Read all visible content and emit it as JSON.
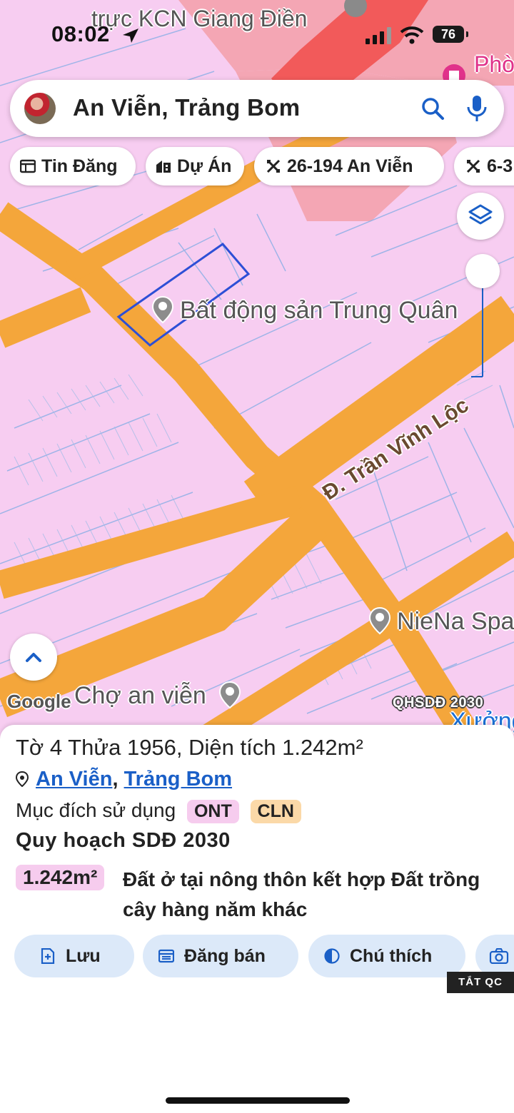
{
  "status_bar": {
    "time": "08:02",
    "battery": "76"
  },
  "map": {
    "top_label": "trực KCN Giang Điền",
    "corner_label": "Phò",
    "pins": [
      {
        "label": "Bất động sản Trung Quân"
      },
      {
        "label": "NieNa Spa"
      },
      {
        "label": "Chợ an viễn"
      },
      {
        "label": "Xưởng"
      }
    ],
    "road_label": "Đ. Trần Vĩnh Lộc",
    "google_logo": "Google",
    "plan_label": "QHSDĐ 2030",
    "colors": {
      "land": "#f7cdf1",
      "road": "#f4a63b",
      "pink_zone": "#f4a6b4",
      "red_zone": "#f25a5a"
    }
  },
  "search": {
    "query": "An Viễn, Trảng Bom"
  },
  "chips": [
    {
      "label": "Tin Đăng",
      "icon": "listing-icon"
    },
    {
      "label": "Dự Án",
      "icon": "building-icon"
    },
    {
      "label": "26-194 An Viễn",
      "icon": "parcel-icon"
    },
    {
      "label": "6-3",
      "icon": "parcel-icon"
    }
  ],
  "sheet": {
    "title": "Tờ 4 Thửa 1956, Diện tích 1.242m²",
    "location": {
      "commune": "An Viễn",
      "sep": ",",
      "district": "Trảng Bom"
    },
    "purpose_label": "Mục đích sử dụng",
    "tags": [
      {
        "text": "ONT",
        "color": "#f6ccee"
      },
      {
        "text": "CLN",
        "color": "#fbd9a8"
      }
    ],
    "plan_title": "Quy hoạch SDĐ 2030",
    "area": "1.242m²",
    "description": "Đất ở tại nông thôn kết hợp Đất trồng cây hàng năm khác",
    "actions": [
      {
        "label": "Lưu",
        "icon": "save-icon"
      },
      {
        "label": "Đăng bán",
        "icon": "sell-icon"
      },
      {
        "label": "Chú thích",
        "icon": "legend-icon"
      },
      {
        "label": "",
        "icon": "camera-icon"
      }
    ],
    "ad_tag": "TẮT QC"
  }
}
